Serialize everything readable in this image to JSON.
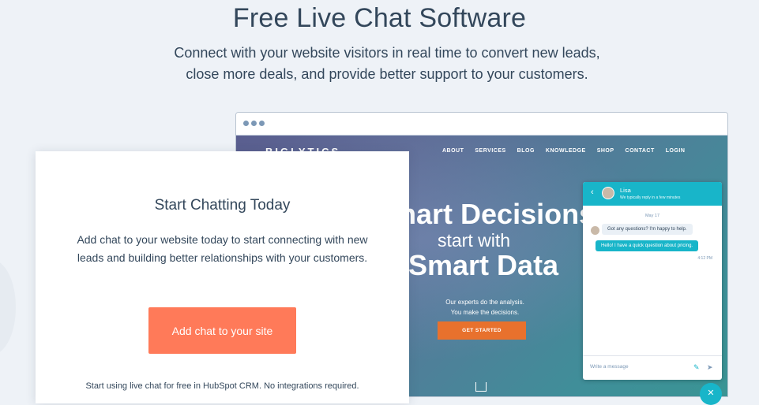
{
  "hero": {
    "title": "Free Live Chat Software",
    "subtitle_line1": "Connect with your website visitors in real time to convert new leads,",
    "subtitle_line2": "close more deals, and provide better support to your customers."
  },
  "site": {
    "logo": "BIGLYTICS",
    "nav": [
      "ABOUT",
      "SERVICES",
      "BLOG",
      "KNOWLEDGE",
      "SHOP",
      "CONTACT",
      "LOGIN"
    ],
    "headline1": "mart Decisions",
    "headline2": "start with",
    "headline3": "Smart Data",
    "copy_line1": "Our experts do the analysis.",
    "copy_line2": "You make the decisions.",
    "cta": "GET STARTED"
  },
  "chat": {
    "agent_name": "Lisa",
    "status": "We typically reply in a few minutes",
    "date": "May 17",
    "incoming": "Got any questions? I'm happy to help.",
    "outgoing": "Hello! I have a quick question about pricing.",
    "time": "4:12 PM",
    "placeholder": "Write a message"
  },
  "card": {
    "title": "Start Chatting Today",
    "text": "Add chat to your website today to start connecting with new leads and building better relationships with your customers.",
    "button": "Add chat to your site",
    "footer": "Start using live chat for free in HubSpot CRM. No integrations required."
  }
}
